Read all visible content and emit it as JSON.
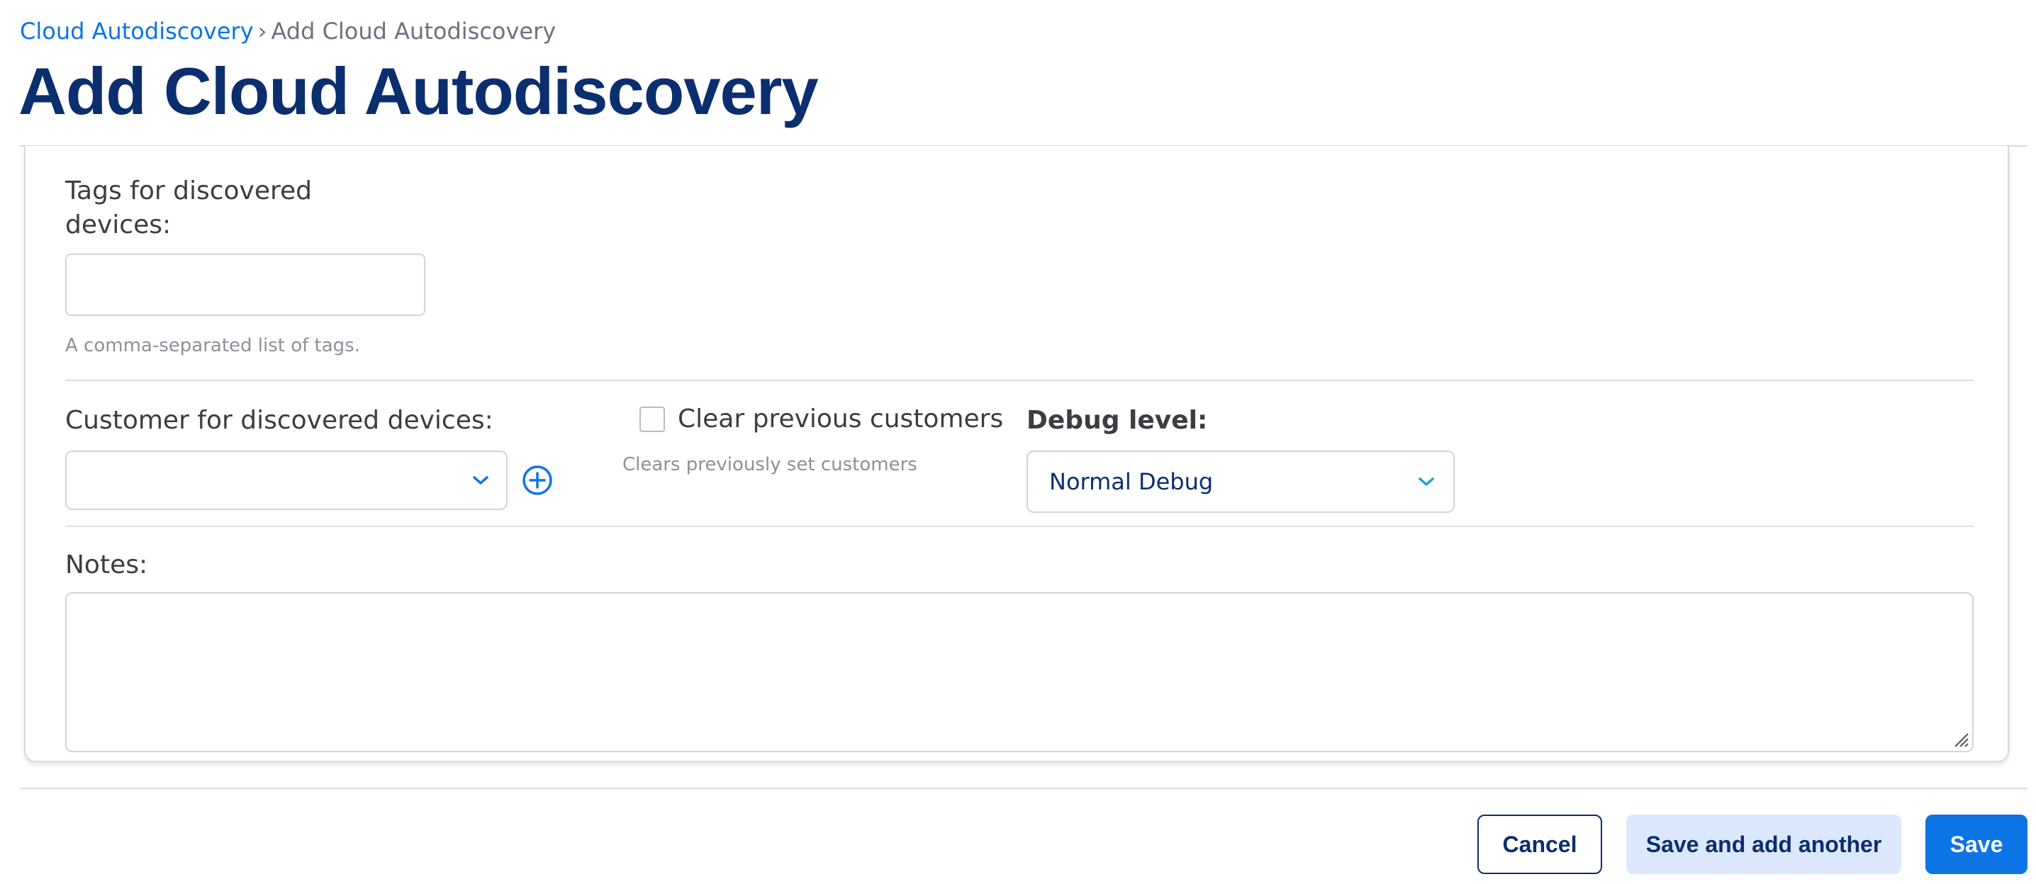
{
  "breadcrumb": {
    "parent": "Cloud Autodiscovery",
    "separator": "›",
    "current": "Add Cloud Autodiscovery"
  },
  "page_title": "Add Cloud Autodiscovery",
  "form": {
    "tags": {
      "label_line1": "Tags for discovered",
      "label_line2": "devices:",
      "value": "",
      "help": "A comma-separated list of tags."
    },
    "customer": {
      "label": "Customer for discovered devices:",
      "value": "",
      "add_icon": "plus-circle-icon"
    },
    "clear_customers": {
      "label": "Clear previous customers",
      "checked": false,
      "help": "Clears previously set customers"
    },
    "debug_level": {
      "label": "Debug level:",
      "value": "Normal Debug"
    },
    "notes": {
      "label": "Notes:",
      "value": ""
    }
  },
  "actions": {
    "cancel": "Cancel",
    "save_add_another": "Save and add another",
    "save": "Save"
  },
  "colors": {
    "accent": "#0c74e4",
    "title": "#0b2e6f",
    "secondary_button_bg": "#dbe8fb"
  }
}
